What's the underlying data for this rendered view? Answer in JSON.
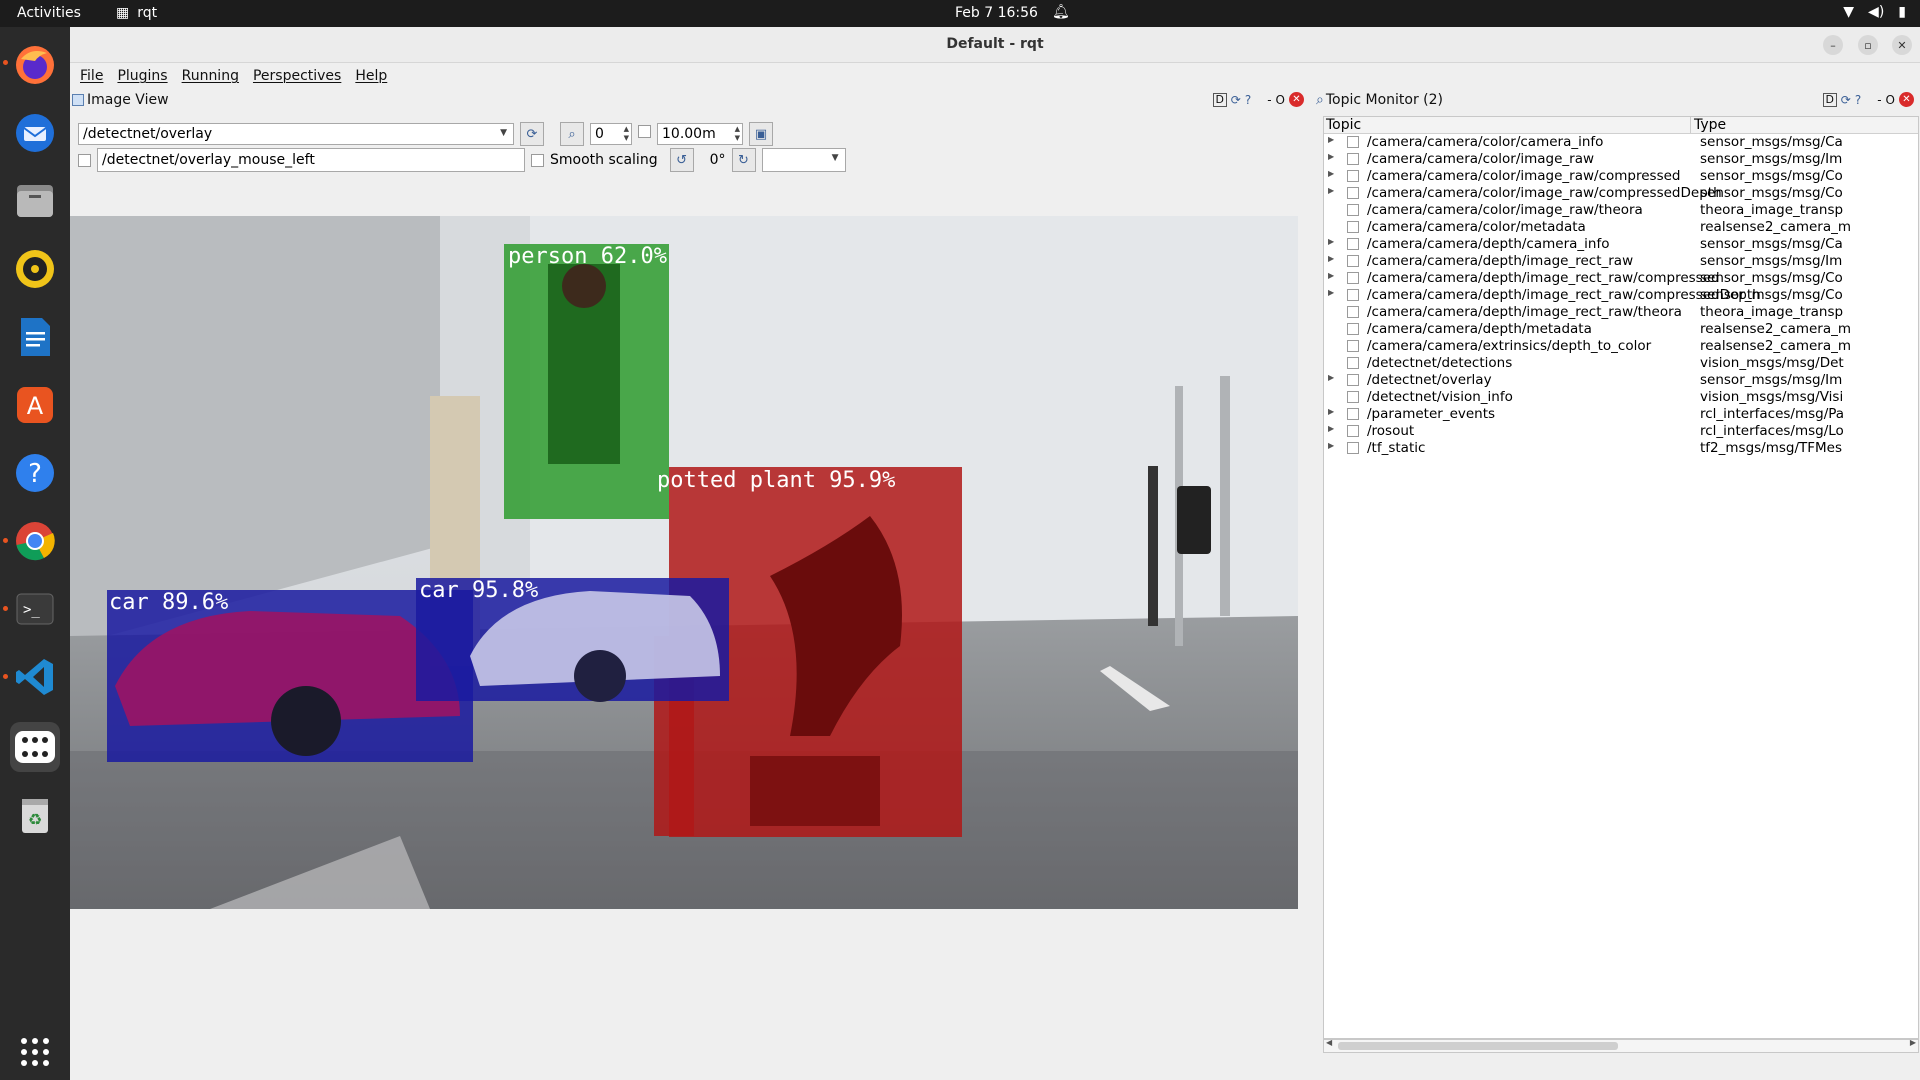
{
  "topbar": {
    "activities": "Activities",
    "app_name": "rqt",
    "clock": "Feb 7  16:56"
  },
  "dock": {
    "items": [
      "firefox-icon",
      "thunderbird-icon",
      "files-icon",
      "rhythmbox-icon",
      "writer-icon",
      "app-center-icon",
      "help-icon",
      "chrome-icon",
      "terminal-icon",
      "vscode-icon",
      "app-grid-icon",
      "trash-icon",
      "show-apps-icon"
    ]
  },
  "window": {
    "title": "Default - rqt",
    "menu": [
      "File",
      "Plugins",
      "Running",
      "Perspectives",
      "Help"
    ]
  },
  "image_view": {
    "title": "Image View",
    "panel_buttons": {
      "d": "D",
      "minus": "-",
      "o": "O"
    },
    "topic": "/detectnet/overlay",
    "zoom_value": "0",
    "max_range": "10.00m",
    "mouse_topic": "/detectnet/overlay_mouse_left",
    "smooth_scaling_label": "Smooth scaling",
    "rotation": "0°"
  },
  "detections": [
    {
      "label": "person 62.0%",
      "color": "#2e9b2e"
    },
    {
      "label": "potted plant 95.9%",
      "color": "#b01818"
    },
    {
      "label": "car 89.6%",
      "color": "#1a1aa0"
    },
    {
      "label": "car 95.8%",
      "color": "#1a1aa0"
    }
  ],
  "topic_monitor": {
    "title": "Topic Monitor (2)",
    "panel_buttons": {
      "d": "D",
      "minus": "-",
      "o": "O"
    },
    "col_topic": "Topic",
    "col_type": "Type",
    "rows": [
      {
        "expandable": true,
        "topic": "/camera/camera/color/camera_info",
        "type": "sensor_msgs/msg/Ca"
      },
      {
        "expandable": true,
        "topic": "/camera/camera/color/image_raw",
        "type": "sensor_msgs/msg/Im"
      },
      {
        "expandable": true,
        "topic": "/camera/camera/color/image_raw/compressed",
        "type": "sensor_msgs/msg/Co"
      },
      {
        "expandable": true,
        "topic": "/camera/camera/color/image_raw/compressedDepth",
        "type": "sensor_msgs/msg/Co"
      },
      {
        "expandable": false,
        "topic": "/camera/camera/color/image_raw/theora",
        "type": "theora_image_transp"
      },
      {
        "expandable": false,
        "topic": "/camera/camera/color/metadata",
        "type": "realsense2_camera_m"
      },
      {
        "expandable": true,
        "topic": "/camera/camera/depth/camera_info",
        "type": "sensor_msgs/msg/Ca"
      },
      {
        "expandable": true,
        "topic": "/camera/camera/depth/image_rect_raw",
        "type": "sensor_msgs/msg/Im"
      },
      {
        "expandable": true,
        "topic": "/camera/camera/depth/image_rect_raw/compressed",
        "type": "sensor_msgs/msg/Co"
      },
      {
        "expandable": true,
        "topic": "/camera/camera/depth/image_rect_raw/compressedDepth",
        "type": "sensor_msgs/msg/Co"
      },
      {
        "expandable": false,
        "topic": "/camera/camera/depth/image_rect_raw/theora",
        "type": "theora_image_transp"
      },
      {
        "expandable": false,
        "topic": "/camera/camera/depth/metadata",
        "type": "realsense2_camera_m"
      },
      {
        "expandable": false,
        "topic": "/camera/camera/extrinsics/depth_to_color",
        "type": "realsense2_camera_m"
      },
      {
        "expandable": false,
        "topic": "/detectnet/detections",
        "type": "vision_msgs/msg/Det"
      },
      {
        "expandable": true,
        "topic": "/detectnet/overlay",
        "type": "sensor_msgs/msg/Im"
      },
      {
        "expandable": false,
        "topic": "/detectnet/vision_info",
        "type": "vision_msgs/msg/Visi"
      },
      {
        "expandable": true,
        "topic": "/parameter_events",
        "type": "rcl_interfaces/msg/Pa"
      },
      {
        "expandable": true,
        "topic": "/rosout",
        "type": "rcl_interfaces/msg/Lo"
      },
      {
        "expandable": true,
        "topic": "/tf_static",
        "type": "tf2_msgs/msg/TFMes"
      }
    ]
  }
}
